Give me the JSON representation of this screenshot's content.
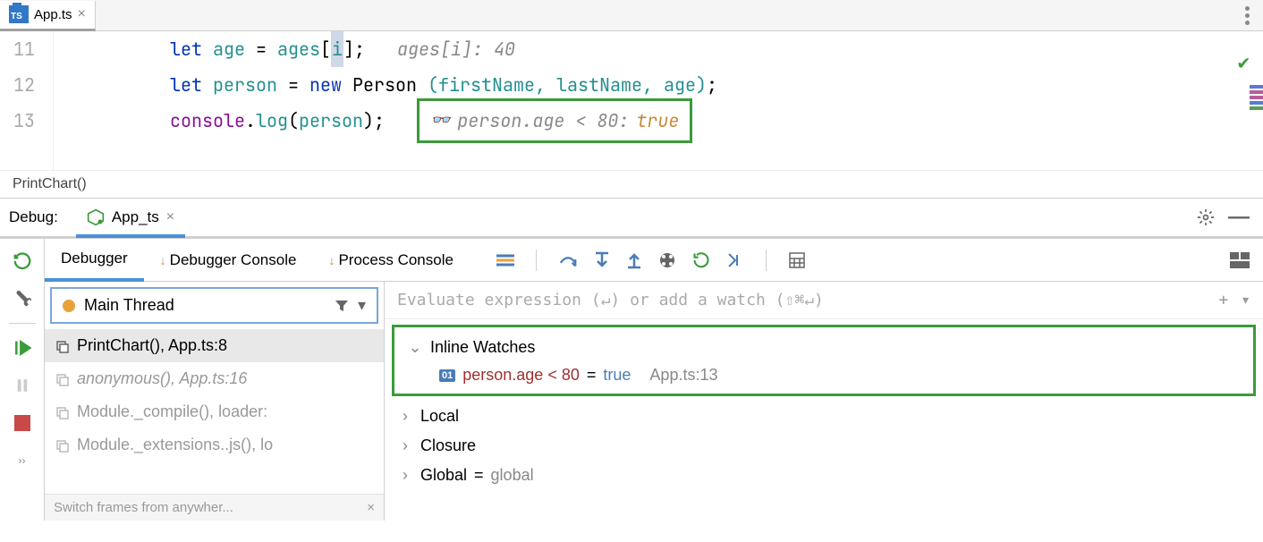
{
  "tabs": {
    "file": {
      "name": "App.ts",
      "icon": "TS"
    }
  },
  "editor": {
    "lines": [
      {
        "num": "11",
        "tokens": {
          "kw": "let",
          "var": "age",
          "eq": " = ",
          "arr": "ages",
          "lb": "[",
          "idx": "i",
          "rb": "]",
          "sc": ";",
          "sp": "   ",
          "hint": "ages[i]: 40"
        }
      },
      {
        "num": "12",
        "tokens": {
          "kw": "let",
          "var": "person",
          "eq": " = ",
          "new": "new",
          "cls": "Person",
          "args": "(firstName, lastName, age)",
          "sc": ";"
        }
      },
      {
        "num": "13",
        "tokens": {
          "obj": "console",
          "dot": ".",
          "fn": "log",
          "lp": "(",
          "arg": "person",
          "rp": ")",
          "sc": ";",
          "sp": "   ",
          "watch_expr": "person.age < 80:",
          "watch_val": "true"
        }
      }
    ]
  },
  "breadcrumb": "PrintChart()",
  "debug": {
    "label": "Debug:",
    "config": "App_ts",
    "sub_tabs": {
      "debugger": "Debugger",
      "dbg_console": "Debugger Console",
      "proc_console": "Process Console"
    },
    "thread": {
      "name": "Main Thread"
    },
    "frames": [
      {
        "name": "PrintChart(), App.ts:8",
        "active": true
      },
      {
        "name": "anonymous(), App.ts:16",
        "italic": true
      },
      {
        "name": "Module._compile(), loader:"
      },
      {
        "name": "Module._extensions..js(), lo"
      }
    ],
    "tip": "Switch frames from anywher...",
    "watch_placeholder": "Evaluate expression (↵) or add a watch (⇧⌘↵)",
    "inline_watches": {
      "title": "Inline Watches",
      "items": [
        {
          "badge": "01",
          "expr": "person.age < 80",
          "eq": " = ",
          "val": "true",
          "loc": "App.ts:13"
        }
      ]
    },
    "scopes": {
      "local": "Local",
      "closure": "Closure",
      "global": "Global",
      "global_val": "global"
    }
  }
}
